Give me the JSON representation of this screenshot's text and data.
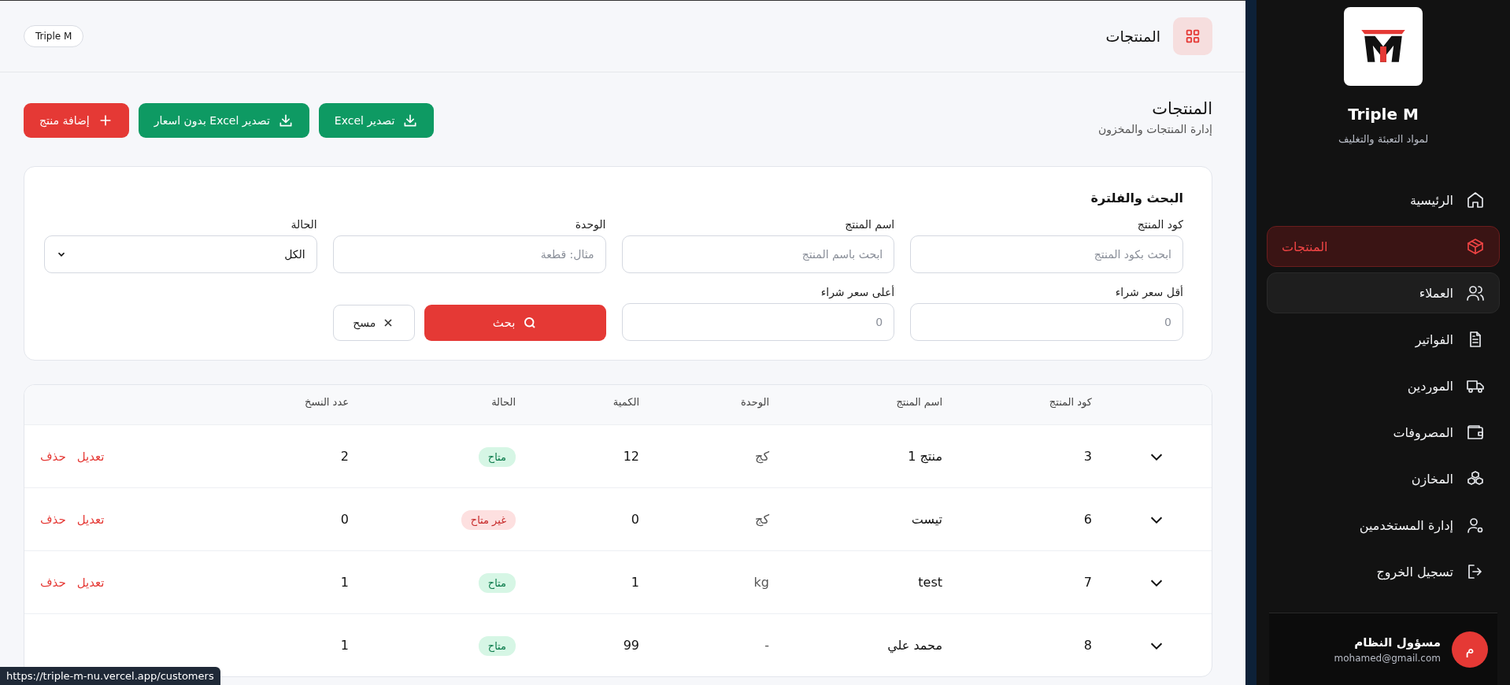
{
  "header": {
    "title": "المنتجات",
    "brand_tag": "Triple M"
  },
  "page": {
    "title": "المنتجات",
    "subtitle": "إدارة المنتجات والمخزون"
  },
  "actions": [
    {
      "kind": "export",
      "label": "تصدير Excel"
    },
    {
      "kind": "export",
      "label": "تصدير Excel بدون اسعار"
    },
    {
      "kind": "add",
      "label": "إضافة منتج"
    }
  ],
  "filters": {
    "title": "البحث والفلترة",
    "fields": [
      {
        "kind": "input",
        "label": "كود المنتج",
        "placeholder": "ابحث بكود المنتج"
      },
      {
        "kind": "input",
        "label": "اسم المنتج",
        "placeholder": "ابحث باسم المنتج"
      },
      {
        "kind": "input",
        "label": "الوحدة",
        "placeholder": "مثال: قطعة"
      },
      {
        "kind": "select",
        "label": "الحالة",
        "value": "الكل"
      },
      {
        "kind": "input",
        "label": "أقل سعر شراء",
        "placeholder": "0"
      },
      {
        "kind": "input",
        "label": "أعلى سعر شراء",
        "placeholder": "0"
      }
    ],
    "search_button": "بحث",
    "clear_button": "مسح"
  },
  "table": {
    "columns": [
      "كود المنتج",
      "اسم المنتج",
      "الوحدة",
      "الكمية",
      "الحالة",
      "عدد النسخ"
    ],
    "rows": [
      {
        "code": "3",
        "name": "منتج 1",
        "unit": "كج",
        "quantity": "12",
        "status": "متاح",
        "available": true,
        "copies": "2",
        "edit": "تعديل",
        "delete": "حذف"
      },
      {
        "code": "6",
        "name": "تيست",
        "unit": "كج",
        "quantity": "0",
        "status": "غير متاح",
        "available": false,
        "copies": "0",
        "edit": "تعديل",
        "delete": "حذف"
      },
      {
        "code": "7",
        "name": "test",
        "unit": "kg",
        "quantity": "1",
        "status": "متاح",
        "available": true,
        "copies": "1",
        "edit": "تعديل",
        "delete": "حذف"
      },
      {
        "code": "8",
        "name": "محمد علي",
        "unit": "-",
        "quantity": "99",
        "status": "متاح",
        "available": true,
        "copies": "1"
      }
    ]
  },
  "sidebar": {
    "brand": "Triple M",
    "tagline": "لمواد التعبئة والتغليف",
    "items": [
      {
        "label": "الرئيسية",
        "selected": false,
        "hovered": false
      },
      {
        "label": "المنتجات",
        "selected": true,
        "hovered": false
      },
      {
        "label": "العملاء",
        "selected": false,
        "hovered": true
      },
      {
        "label": "الفواتير",
        "selected": false,
        "hovered": false
      },
      {
        "label": "الموردين",
        "selected": false,
        "hovered": false
      },
      {
        "label": "المصروفات",
        "selected": false,
        "hovered": false
      },
      {
        "label": "المخازن",
        "selected": false,
        "hovered": false
      },
      {
        "label": "إدارة المستخدمين",
        "selected": false,
        "hovered": false
      },
      {
        "label": "تسجيل الخروج",
        "selected": false,
        "hovered": false
      }
    ],
    "user": {
      "initial": "م",
      "name": "مسؤول النظام",
      "email": "mohamed@gmail.com"
    }
  },
  "status_url": "https://triple-m-nu.vercel.app/customers"
}
